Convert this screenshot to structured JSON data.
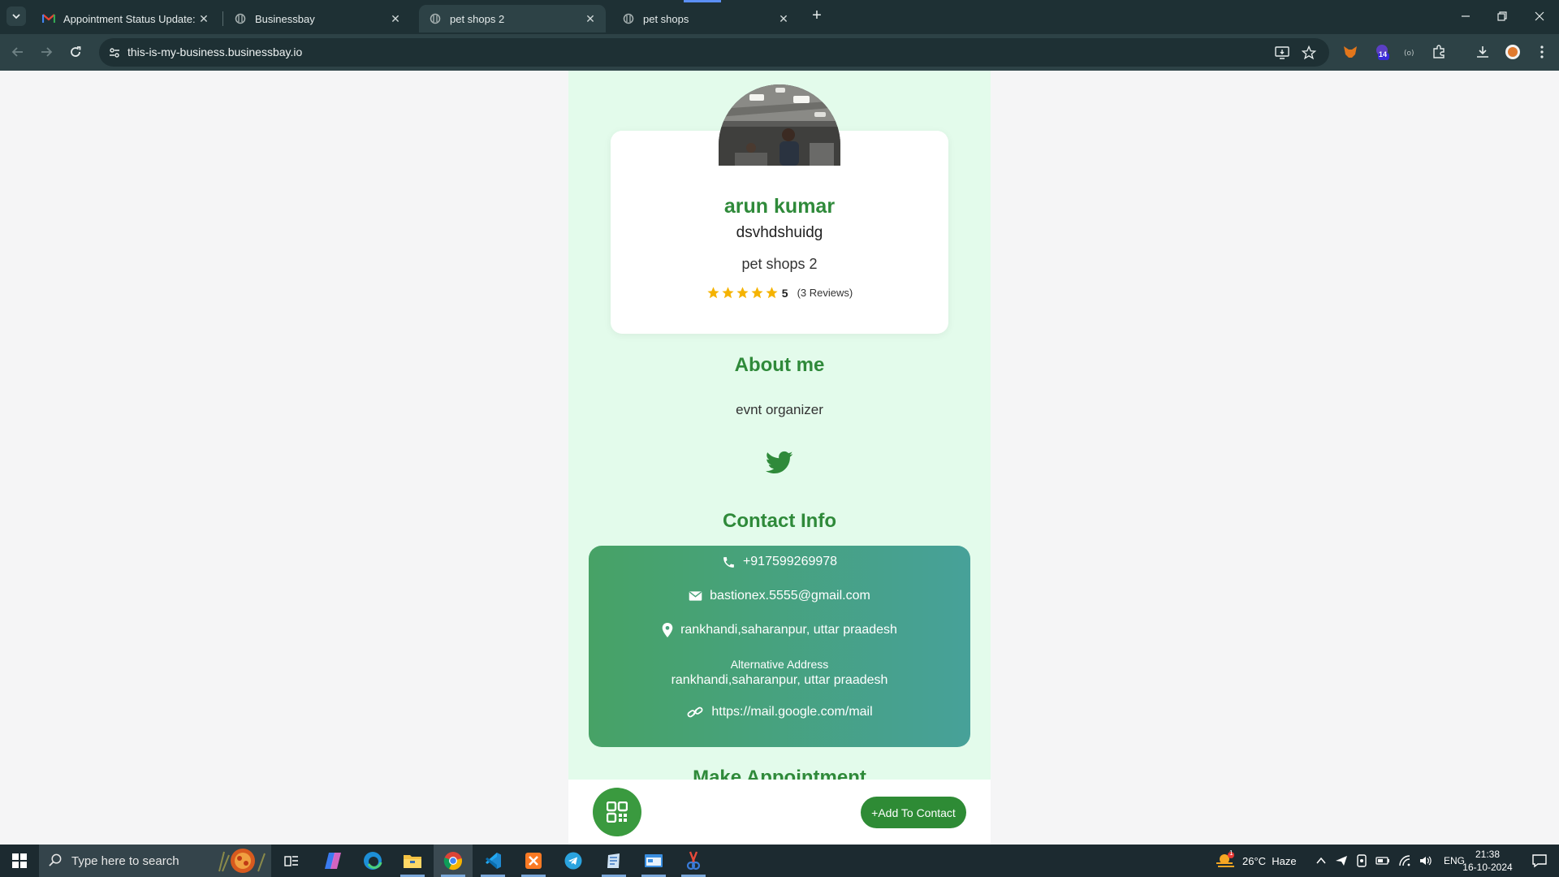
{
  "browser": {
    "tabs": [
      {
        "title": "Appointment Status Update: dr",
        "favicon": "gmail-icon",
        "active": false
      },
      {
        "title": "Businessbay",
        "favicon": "site-icon",
        "active": false
      },
      {
        "title": "pet shops 2",
        "favicon": "site-icon",
        "active": true
      },
      {
        "title": "pet shops",
        "favicon": "site-icon",
        "active": false
      }
    ],
    "url": "this-is-my-business.businessbay.io",
    "extension_badge": "14"
  },
  "profile": {
    "name": "arun kumar",
    "subtitle": "dsvhdshuidg",
    "business": "pet shops 2",
    "rating": 5,
    "rating_label": "5",
    "reviews_label": "(3 Reviews)"
  },
  "about": {
    "title": "About me",
    "text": "evnt organizer"
  },
  "contact": {
    "title": "Contact Info",
    "phone": "+917599269978",
    "email": "bastionex.5555@gmail.com",
    "address": "rankhandi,saharanpur, uttar praadesh",
    "alt_address_label": "Alternative Address",
    "alt_address": "rankhandi,saharanpur, uttar praadesh",
    "website": "https://mail.google.com/mail"
  },
  "appointment": {
    "title": "Make Appointment"
  },
  "actions": {
    "add_contact": "+Add To Contact"
  },
  "taskbar": {
    "search_placeholder": "Type here to search",
    "weather": "26°C  Haze",
    "weather_badge": "1",
    "language": "ENG",
    "time": "21:38",
    "date": "16-10-2024"
  },
  "colors": {
    "brand_green": "#2f8a3a",
    "page_bg": "#e3fbeb",
    "contact_gradient_start": "#47a266",
    "contact_gradient_end": "#47a199"
  }
}
